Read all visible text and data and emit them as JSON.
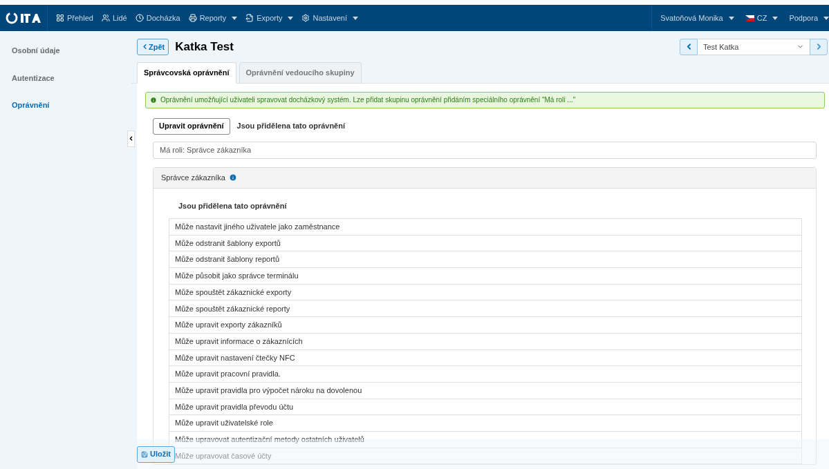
{
  "navbar": {
    "items": [
      "Přehled",
      "Lidé",
      "Docházka",
      "Reporty",
      "Exporty",
      "Nastavení"
    ],
    "right": [
      "Svatoňová Monika",
      "CZ",
      "Podpora"
    ]
  },
  "sidebar": {
    "items": [
      {
        "label": "Osobní údaje",
        "selected": false
      },
      {
        "label": "Autentizace",
        "selected": false
      },
      {
        "label": "Oprávnění",
        "selected": true
      }
    ]
  },
  "header": {
    "back": "Zpět",
    "title": "Katka Test",
    "user_select": "Test Katka"
  },
  "tabs": [
    {
      "label": "Správcovská oprávnění",
      "selected": true
    },
    {
      "label": "Oprávnění vedoucího skupiny",
      "selected": false
    }
  ],
  "alert": "Oprávnění umožňující uživateli spravovat docházkový systém. Lze přidat skupinu oprávnění přidáním speciálního oprávnění \"Má roli ...\"",
  "edit_button": "Upravit oprávnění",
  "assigned_heading": "Jsou přidělena tato oprávnění",
  "role_field": "Má roli: Správce zákazníka",
  "role_panel": {
    "title": "Správce zákazníka",
    "heading": "Jsou přidělena tato oprávnění",
    "permissions": [
      "Může nastavit jiného uživatele jako zaměstnance",
      "Může odstranit šablony exportů",
      "Může odstranit šablony reportů",
      "Může působit jako správce terminálu",
      "Může spouštět zákaznické exporty",
      "Může spouštět zákaznické reporty",
      "Může upravit exporty zákazníků",
      "Může upravit informace o zákaznících",
      "Může upravit nastavení čtečky NFC",
      "Může upravit pracovní pravidla.",
      "Může upravit pravidla pro výpočet nároku na dovolenou",
      "Může upravit pravidla převodu účtu",
      "Může upravit uživatelské role",
      "Může upravovat autentizační metody ostatních uživatelů",
      "Může upravovat časové účty"
    ]
  },
  "save_button": "Uložit"
}
